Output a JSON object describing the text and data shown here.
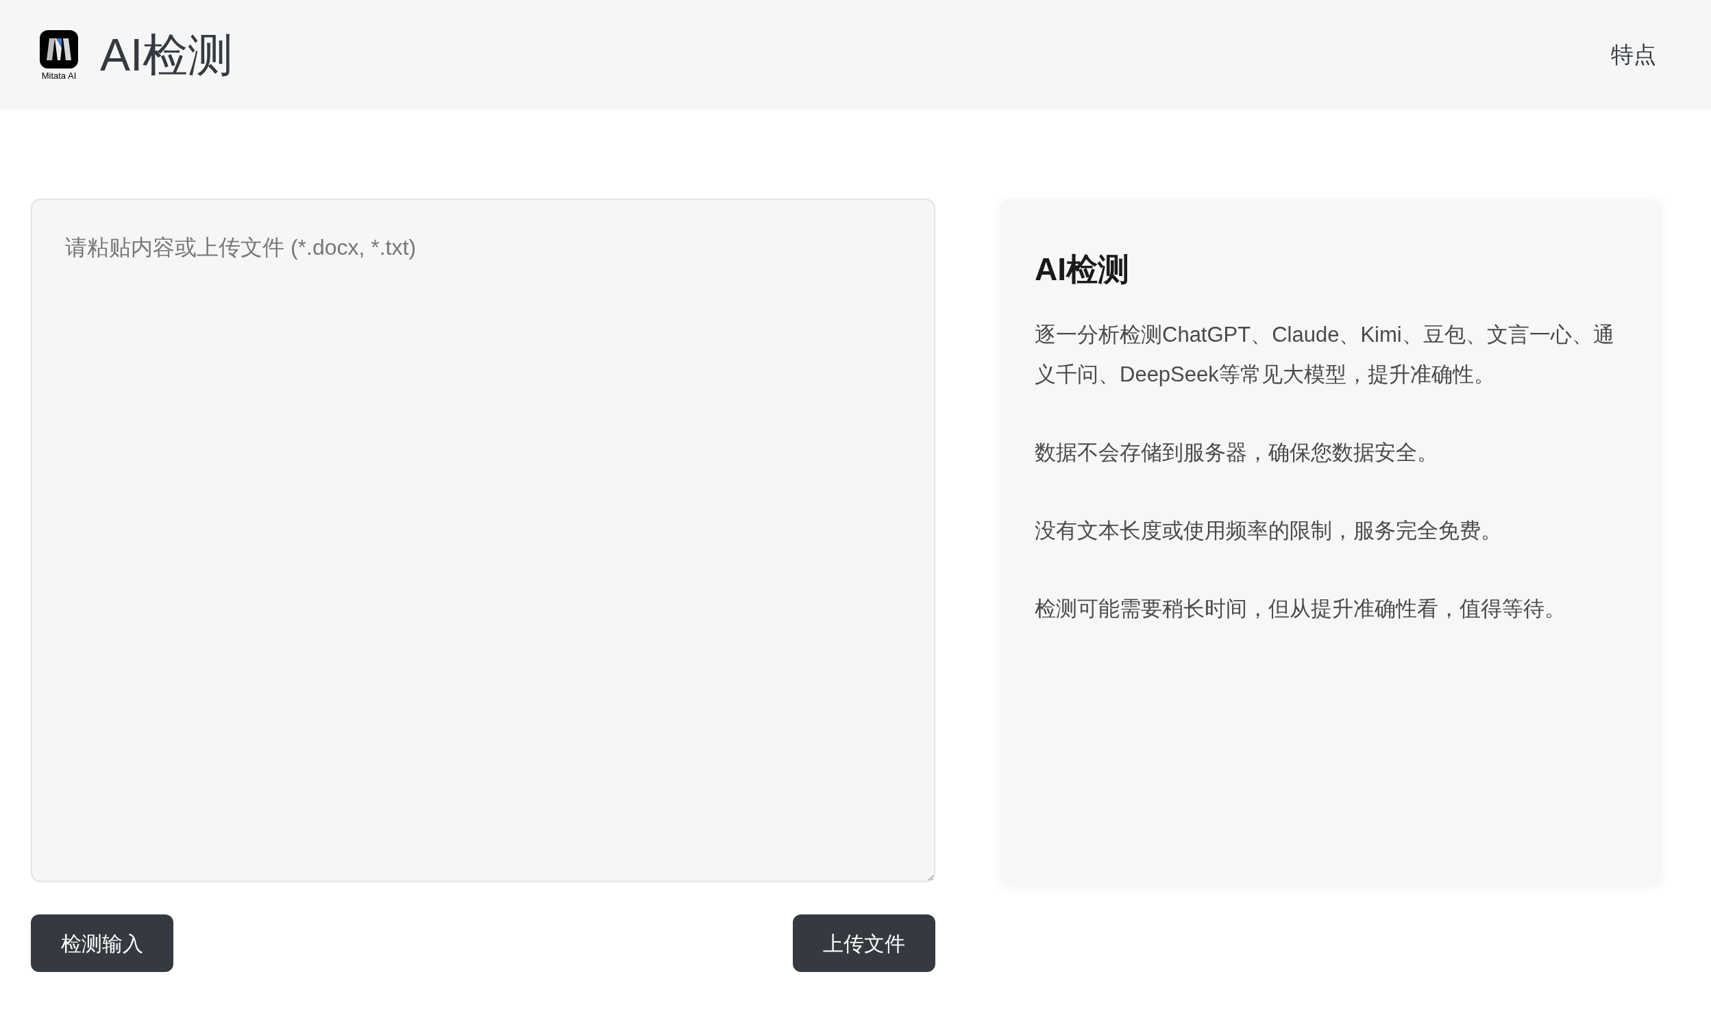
{
  "header": {
    "logo_caption": "Mitata AI",
    "title": "AI检测",
    "nav": [
      {
        "label": "特点"
      }
    ]
  },
  "input": {
    "placeholder": "请粘贴内容或上传文件 (*.docx, *.txt)"
  },
  "buttons": [
    {
      "label": "检测输入"
    },
    {
      "label": "上传文件"
    }
  ],
  "info_card": {
    "title": "AI检测",
    "paragraphs": [
      "逐一分析检测ChatGPT、Claude、Kimi、豆包、文言一心、通义千问、DeepSeek等常见大模型，提升准确性。",
      "数据不会存储到服务器，确保您数据安全。",
      "没有文本长度或使用频率的限制，服务完全免费。",
      "检测可能需要稍长时间，但从提升准确性看，值得等待。"
    ]
  }
}
